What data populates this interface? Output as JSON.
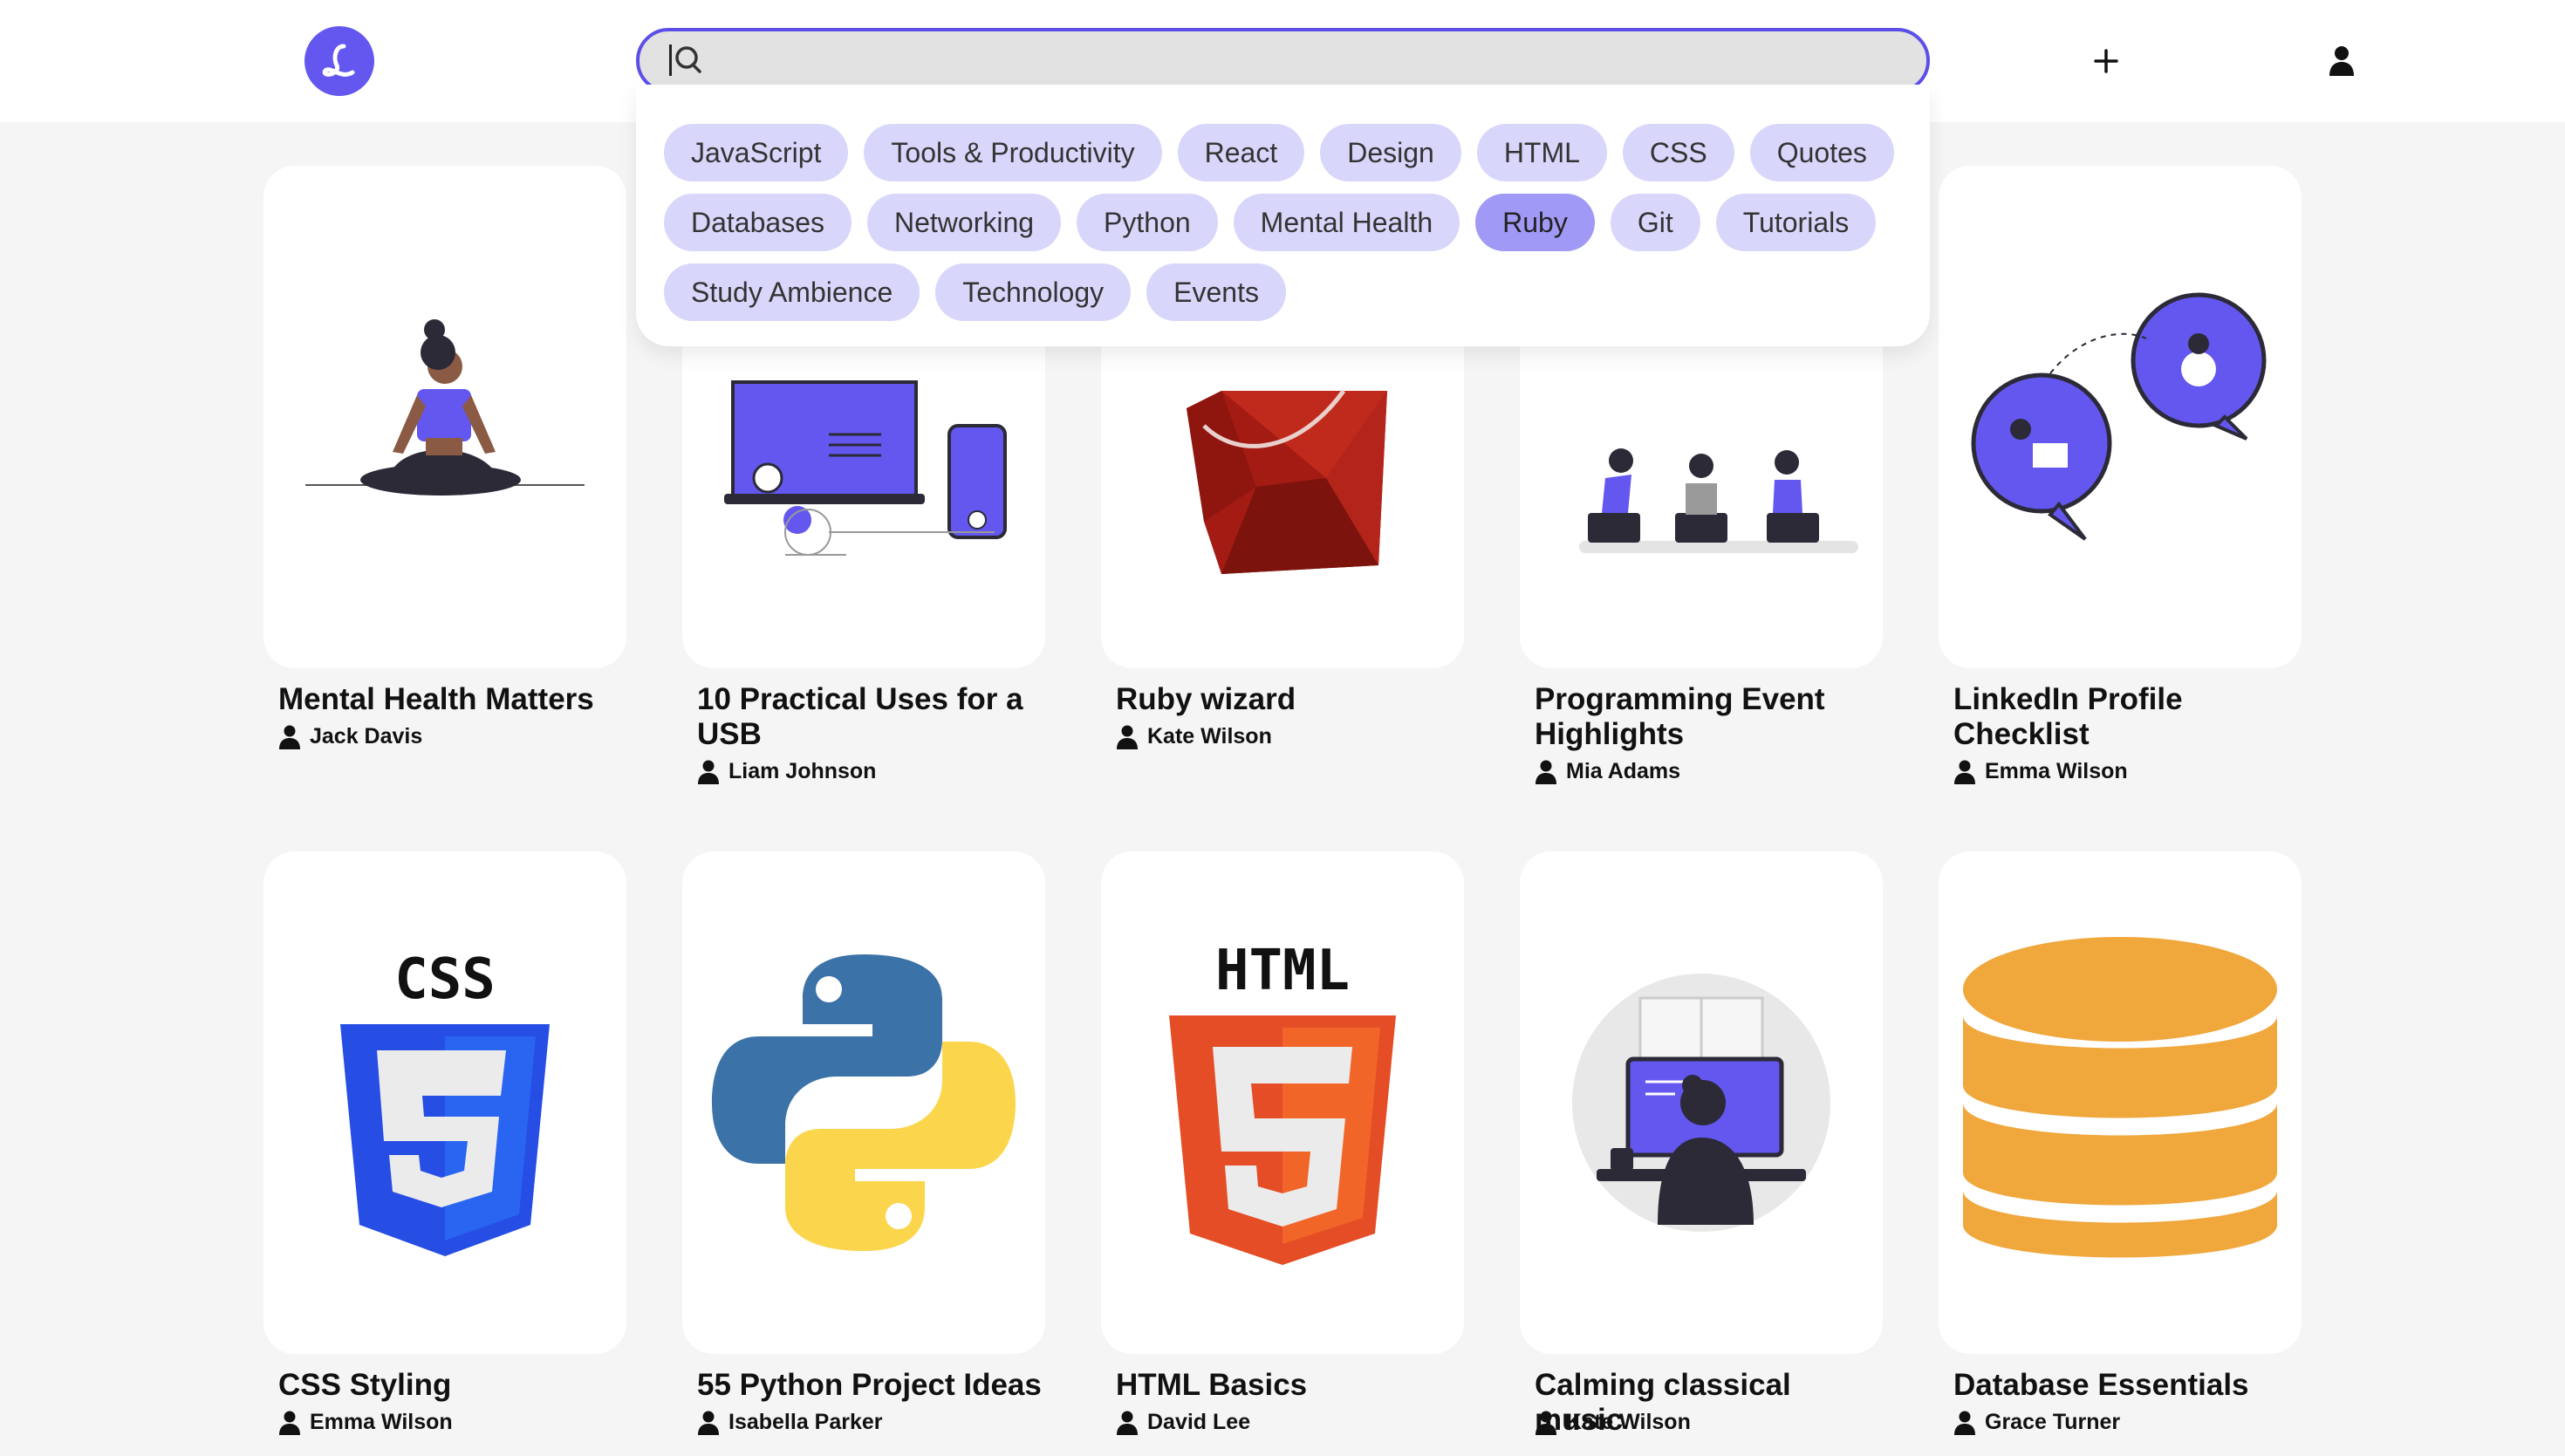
{
  "search": {
    "placeholder": "",
    "value": ""
  },
  "tags": [
    {
      "label": "JavaScript",
      "active": false
    },
    {
      "label": "Tools & Productivity",
      "active": false
    },
    {
      "label": "React",
      "active": false
    },
    {
      "label": "Design",
      "active": false
    },
    {
      "label": "HTML",
      "active": false
    },
    {
      "label": "CSS",
      "active": false
    },
    {
      "label": "Quotes",
      "active": false
    },
    {
      "label": "Databases",
      "active": false
    },
    {
      "label": "Networking",
      "active": false
    },
    {
      "label": "Python",
      "active": false
    },
    {
      "label": "Mental Health",
      "active": false
    },
    {
      "label": "Ruby",
      "active": true
    },
    {
      "label": "Git",
      "active": false
    },
    {
      "label": "Tutorials",
      "active": false
    },
    {
      "label": "Study Ambience",
      "active": false
    },
    {
      "label": "Technology",
      "active": false
    },
    {
      "label": "Events",
      "active": false
    }
  ],
  "cards": [
    {
      "title": "Mental Health Matters",
      "author": "Jack Davis",
      "image": "meditation-illustration"
    },
    {
      "title": "10 Practical Uses for a USB",
      "author": "Liam Johnson",
      "image": "devices-illustration"
    },
    {
      "title": "Ruby wizard",
      "author": "Kate Wilson",
      "image": "ruby-gem-logo"
    },
    {
      "title": "Programming Event Highlights",
      "author": "Mia Adams",
      "image": "meeting-illustration"
    },
    {
      "title": "LinkedIn Profile Checklist",
      "author": "Emma Wilson",
      "image": "chat-bubbles-illustration"
    },
    {
      "title": "CSS Styling",
      "author": "Emma Wilson",
      "image": "css3-logo"
    },
    {
      "title": "55 Python Project Ideas",
      "author": "Isabella Parker",
      "image": "python-logo"
    },
    {
      "title": "HTML Basics",
      "author": "David Lee",
      "image": "html5-logo"
    },
    {
      "title": "Calming classical music",
      "author": "Kate Wilson",
      "image": "working-at-desk-illustration"
    },
    {
      "title": "Database Essentials",
      "author": "Grace Turner",
      "image": "database-icon"
    }
  ],
  "logos": {
    "css": "CSS",
    "html": "HTML"
  },
  "colors": {
    "accent": "#6357f0",
    "chip": "#d9d6fb",
    "chip_active": "#a09af6",
    "background": "#f5f5f5"
  }
}
